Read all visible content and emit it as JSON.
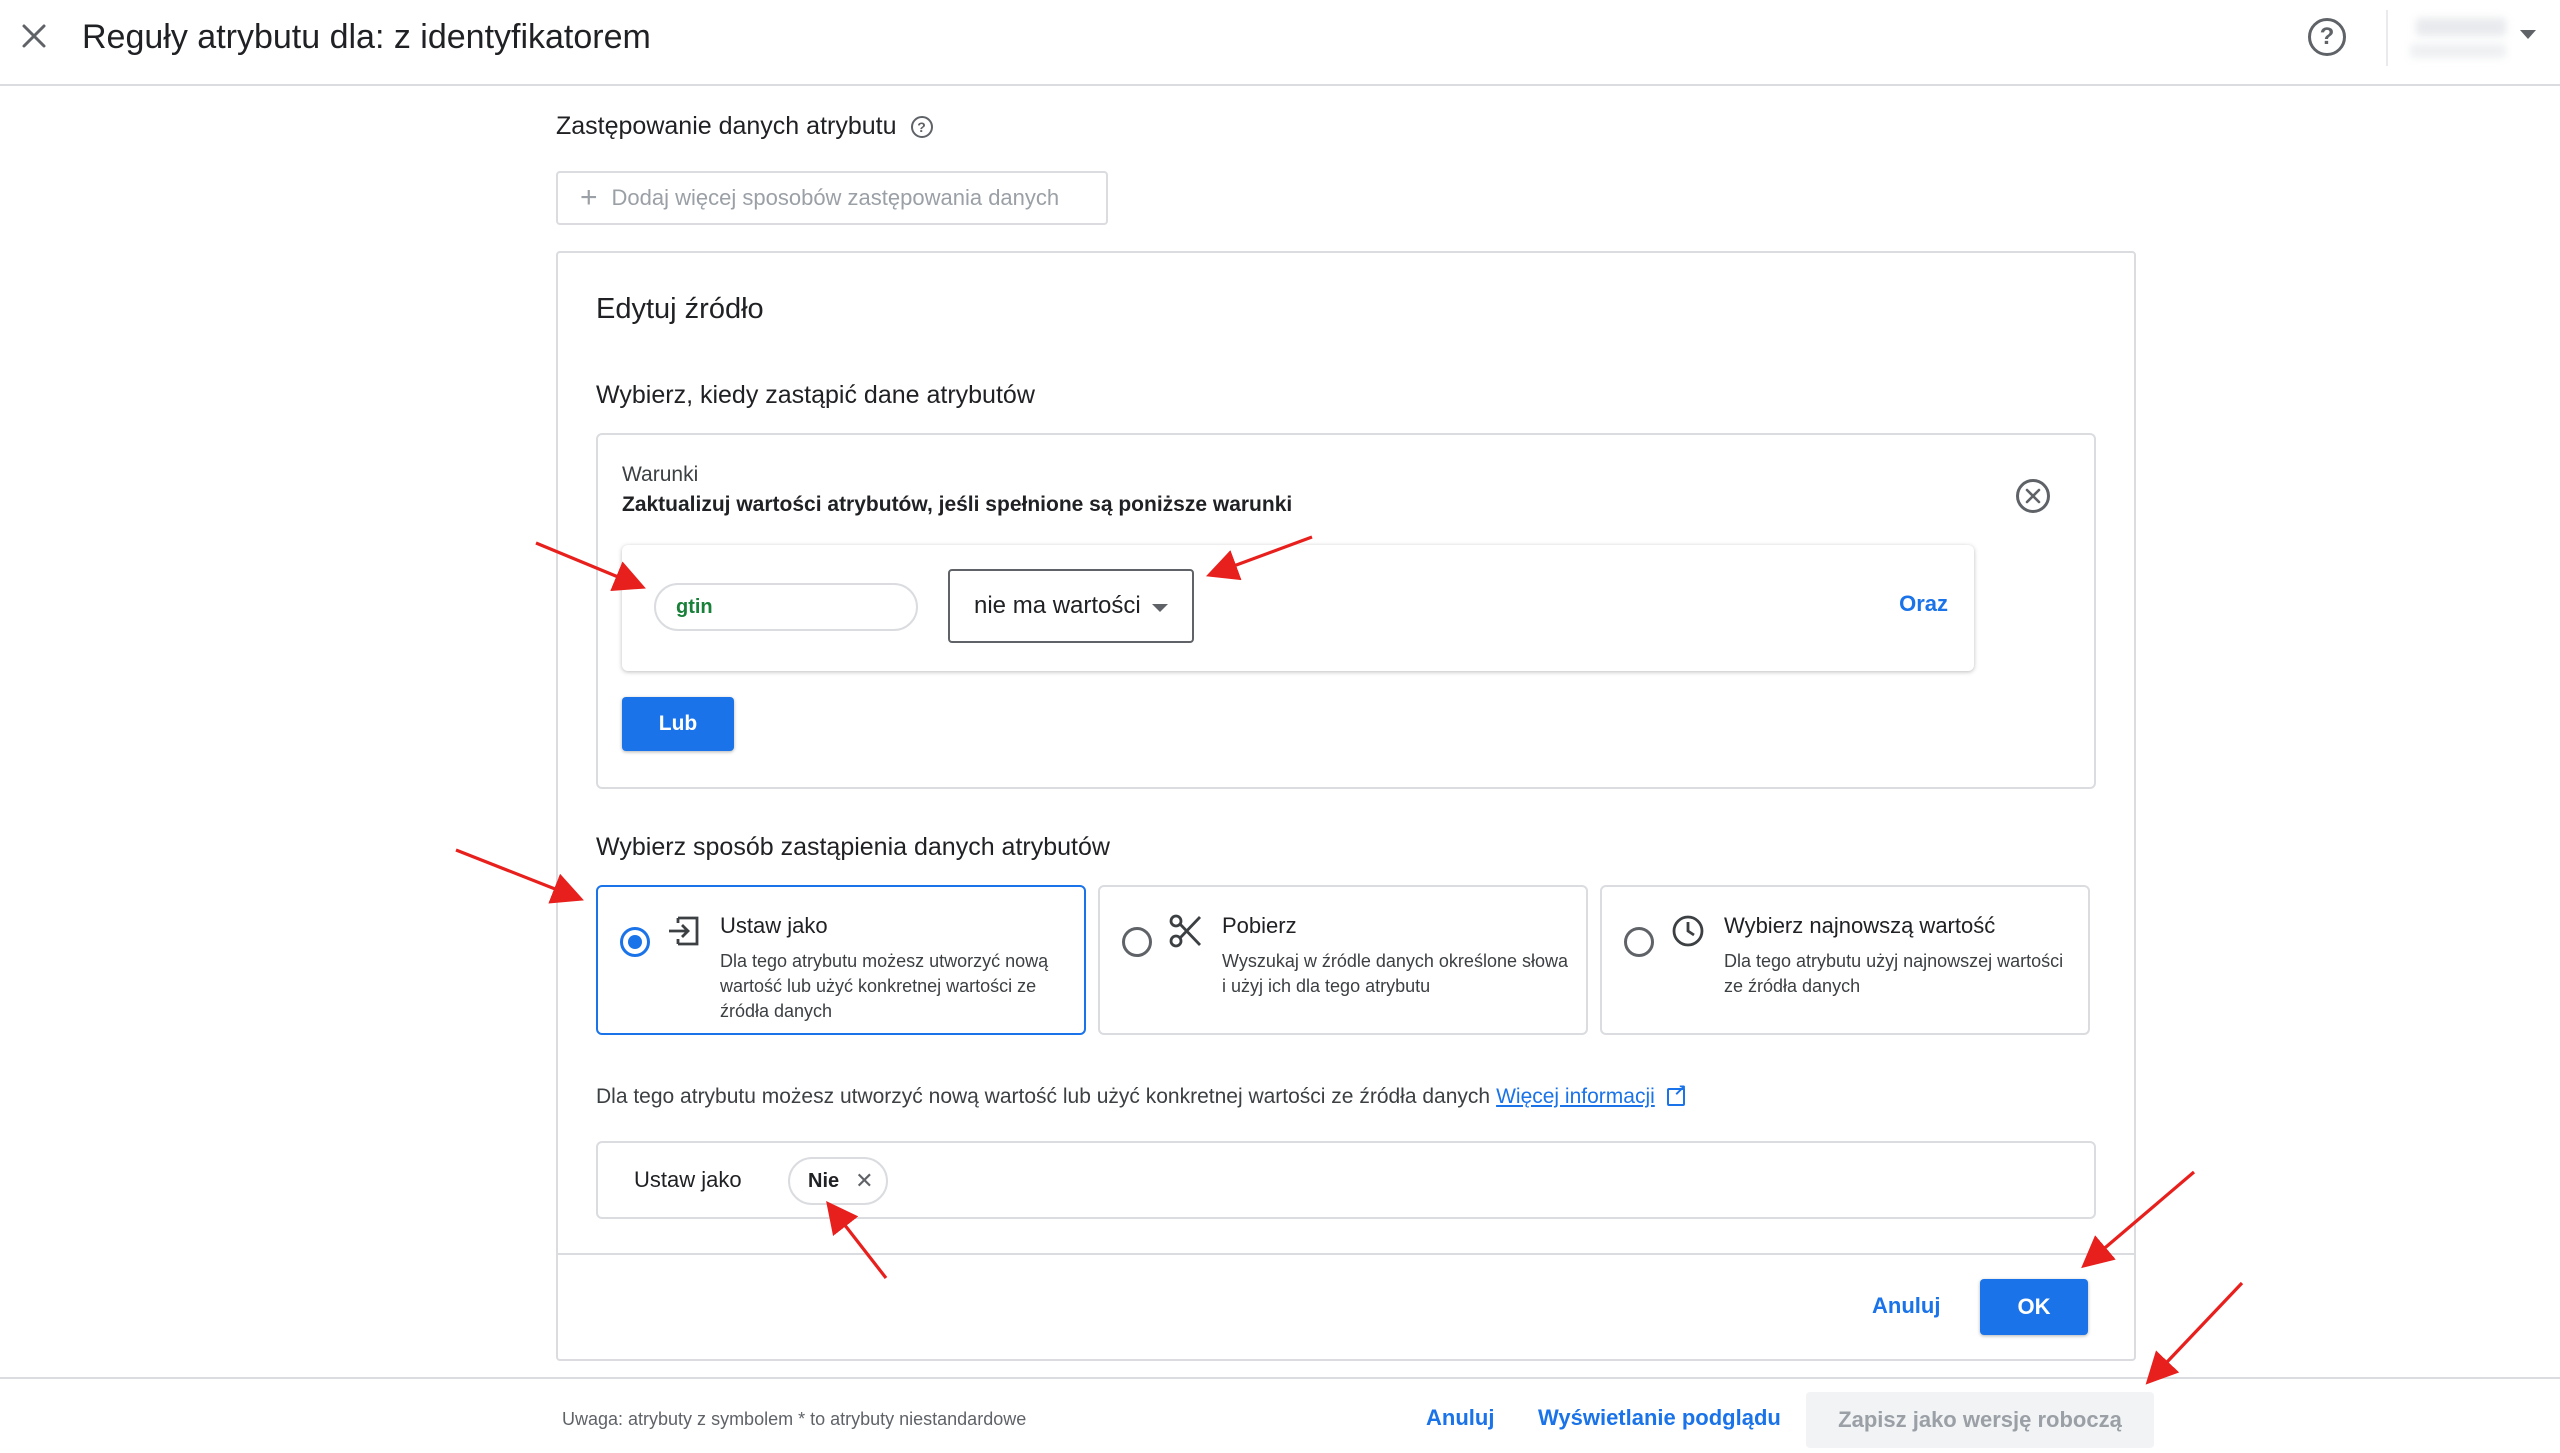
{
  "header": {
    "title": "Reguły atrybutu dla: z identyfikatorem",
    "help_glyph": "?"
  },
  "section": {
    "title": "Zastępowanie danych atrybutu",
    "info_glyph": "?",
    "add_more_label": "Dodaj więcej sposobów zastępowania danych"
  },
  "edit_card": {
    "title": "Edytuj źródło",
    "when_title": "Wybierz, kiedy zastąpić dane atrybutów",
    "conditions": {
      "label": "Warunki",
      "description": "Zaktualizuj wartości atrybutów, jeśli spełnione są poniższe warunki",
      "attribute_chip": "gtin",
      "operator_value": "nie ma wartości",
      "and_label": "Oraz",
      "or_label": "Lub"
    },
    "how_title": "Wybierz sposób zastąpienia danych atrybutów",
    "options": [
      {
        "title": "Ustaw jako",
        "description": "Dla tego atrybutu możesz utworzyć nową wartość lub użyć konkretnej wartości ze źródła danych",
        "icon": "set-as-icon",
        "selected": true
      },
      {
        "title": "Pobierz",
        "description": "Wyszukaj w źródle danych określone słowa i użyj ich dla tego atrybutu",
        "icon": "scissors-icon",
        "selected": false
      },
      {
        "title": "Wybierz najnowszą wartość",
        "description": "Dla tego atrybutu użyj najnowszej wartości ze źródła danych",
        "icon": "clock-icon",
        "selected": false
      }
    ],
    "help_text": "Dla tego atrybutu możesz utworzyć nową wartość lub użyć konkretnej wartości ze źródła danych",
    "help_link": "Więcej informacji",
    "set_as": {
      "label": "Ustaw jako",
      "value_chip": "Nie"
    },
    "cancel_label": "Anuluj",
    "ok_label": "OK"
  },
  "footer": {
    "note": "Uwaga: atrybuty z symbolem * to atrybuty niestandardowe",
    "cancel_label": "Anuluj",
    "preview_label": "Wyświetlanie podglądu",
    "save_draft_label": "Zapisz jako wersję roboczą"
  },
  "colors": {
    "accent": "#1a73e8",
    "attribute_green": "#188038",
    "annotation_arrow": "#e8201d"
  }
}
